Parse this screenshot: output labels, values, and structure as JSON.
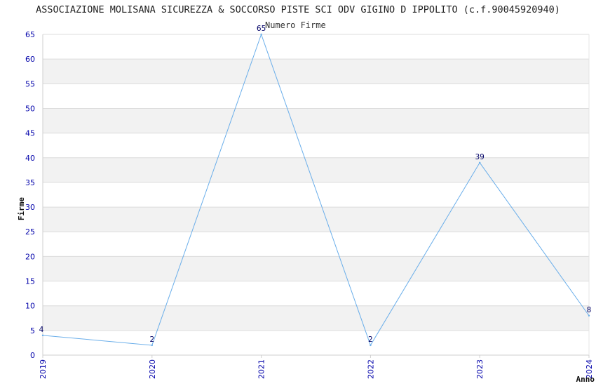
{
  "chart_data": {
    "type": "line",
    "title": "ASSOCIAZIONE MOLISANA SICUREZZA & SOCCORSO PISTE SCI ODV GIGINO D IPPOLITO (c.f.90045920940)",
    "legend": "Numero Firme",
    "xlabel": "Anno",
    "ylabel": "Firme",
    "x": [
      "2019",
      "2020",
      "2021",
      "2022",
      "2023",
      "2024"
    ],
    "series": [
      {
        "name": "Numero Firme",
        "values": [
          4,
          2,
          65,
          2,
          39,
          8
        ]
      }
    ],
    "ylim": [
      0,
      65
    ],
    "yticks": [
      0,
      5,
      10,
      15,
      20,
      25,
      30,
      35,
      40,
      45,
      50,
      55,
      60,
      65
    ],
    "grid": "horizontal bands",
    "line_color": "#6aaeea",
    "tick_color": "#0000aa",
    "band_color": "#f2f2f2"
  }
}
